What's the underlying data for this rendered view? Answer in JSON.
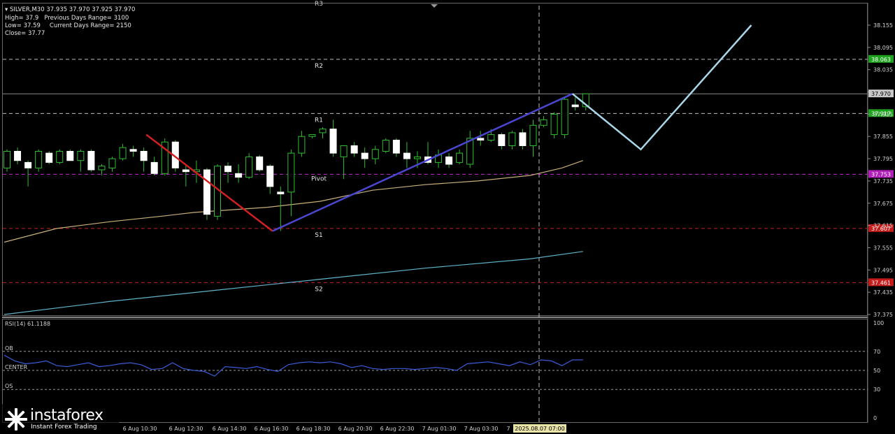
{
  "header": {
    "symbol_line": "SILVER,M30  37.935 37.970 37.925 37.970",
    "high": "High= 37.9",
    "prev_range": "Previous Days Range= 3100",
    "low": "Low= 37.59",
    "curr_range": "Current Days Range= 2150",
    "close": "Close= 37.77"
  },
  "colors": {
    "background": "#000000",
    "bull_candle": "#ffffff",
    "bear_candle": "#ffffff",
    "candle_outline": "#2fbf2f",
    "ma_slow": "#c9b07a",
    "ma_long": "#5fb3c8",
    "zigzag_down": "#d02020",
    "zigzag_up": "#4a46d0",
    "projection": "#a9d6e8",
    "rsi_line": "#3b5bd8",
    "r_level_label": "#1fa31f",
    "pivot_label": "#b01fb8",
    "s_level_label": "#c41b1b",
    "current_price_label": "#c8c8c8"
  },
  "chart_data": [
    {
      "type": "candlestick",
      "title": "SILVER,M30",
      "ylim": [
        37.36,
        38.21
      ],
      "y_ticks": [
        "38.155",
        "38.095",
        "38.035",
        "37.975",
        "37.915",
        "37.855",
        "37.795",
        "37.735",
        "37.675",
        "37.615",
        "37.555",
        "37.495",
        "37.435",
        "37.375"
      ],
      "x_ticks": [
        "6 Aug 10:30",
        "6 Aug 12:30",
        "6 Aug 14:30",
        "6 Aug 16:30",
        "6 Aug 18:30",
        "6 Aug 20:30",
        "6 Aug 22:30",
        "7 Aug 01:30",
        "7 Aug 03:30",
        "7",
        "2025.08.07 07:00"
      ],
      "levels": [
        {
          "name": "R2",
          "value": 38.063,
          "label": "38.063"
        },
        {
          "name": "R1",
          "value": 37.917,
          "label": "37.917"
        },
        {
          "name": "Pivot",
          "value": 37.753,
          "label": "37.753"
        },
        {
          "name": "S1",
          "value": 37.607,
          "label": "37.607"
        },
        {
          "name": "S2",
          "value": 37.461,
          "label": "37.461"
        }
      ],
      "current_price": {
        "value": 37.97,
        "label": "37.970"
      },
      "candles": [
        {
          "o": 37.77,
          "h": 37.82,
          "l": 37.76,
          "c": 37.815
        },
        {
          "o": 37.815,
          "h": 37.825,
          "l": 37.78,
          "c": 37.79
        },
        {
          "o": 37.785,
          "h": 37.79,
          "l": 37.72,
          "c": 37.77
        },
        {
          "o": 37.77,
          "h": 37.82,
          "l": 37.76,
          "c": 37.815
        },
        {
          "o": 37.81,
          "h": 37.815,
          "l": 37.78,
          "c": 37.785
        },
        {
          "o": 37.785,
          "h": 37.82,
          "l": 37.78,
          "c": 37.815
        },
        {
          "o": 37.815,
          "h": 37.82,
          "l": 37.79,
          "c": 37.79
        },
        {
          "o": 37.79,
          "h": 37.82,
          "l": 37.76,
          "c": 37.815
        },
        {
          "o": 37.815,
          "h": 37.82,
          "l": 37.76,
          "c": 37.765
        },
        {
          "o": 37.765,
          "h": 37.78,
          "l": 37.75,
          "c": 37.775
        },
        {
          "o": 37.77,
          "h": 37.8,
          "l": 37.76,
          "c": 37.795
        },
        {
          "o": 37.795,
          "h": 37.835,
          "l": 37.79,
          "c": 37.825
        },
        {
          "o": 37.82,
          "h": 37.83,
          "l": 37.8,
          "c": 37.815
        },
        {
          "o": 37.815,
          "h": 37.825,
          "l": 37.76,
          "c": 37.79
        },
        {
          "o": 37.785,
          "h": 37.8,
          "l": 37.75,
          "c": 37.755
        },
        {
          "o": 37.755,
          "h": 37.85,
          "l": 37.75,
          "c": 37.84
        },
        {
          "o": 37.84,
          "h": 37.845,
          "l": 37.76,
          "c": 37.77
        },
        {
          "o": 37.765,
          "h": 37.78,
          "l": 37.72,
          "c": 37.76
        },
        {
          "o": 37.76,
          "h": 37.79,
          "l": 37.73,
          "c": 37.765
        },
        {
          "o": 37.765,
          "h": 37.77,
          "l": 37.63,
          "c": 37.645
        },
        {
          "o": 37.64,
          "h": 37.78,
          "l": 37.63,
          "c": 37.775
        },
        {
          "o": 37.775,
          "h": 37.785,
          "l": 37.73,
          "c": 37.76
        },
        {
          "o": 37.755,
          "h": 37.78,
          "l": 37.73,
          "c": 37.745
        },
        {
          "o": 37.745,
          "h": 37.81,
          "l": 37.74,
          "c": 37.8
        },
        {
          "o": 37.8,
          "h": 37.805,
          "l": 37.76,
          "c": 37.765
        },
        {
          "o": 37.775,
          "h": 37.78,
          "l": 37.7,
          "c": 37.72
        },
        {
          "o": 37.705,
          "h": 37.72,
          "l": 37.6,
          "c": 37.7
        },
        {
          "o": 37.705,
          "h": 37.82,
          "l": 37.64,
          "c": 37.81
        },
        {
          "o": 37.81,
          "h": 37.87,
          "l": 37.8,
          "c": 37.855
        },
        {
          "o": 37.855,
          "h": 37.86,
          "l": 37.85,
          "c": 37.86
        },
        {
          "o": 37.865,
          "h": 37.88,
          "l": 37.85,
          "c": 37.875
        },
        {
          "o": 37.875,
          "h": 37.9,
          "l": 37.8,
          "c": 37.81
        },
        {
          "o": 37.8,
          "h": 37.81,
          "l": 37.74,
          "c": 37.83
        },
        {
          "o": 37.83,
          "h": 37.84,
          "l": 37.8,
          "c": 37.81
        },
        {
          "o": 37.81,
          "h": 37.825,
          "l": 37.77,
          "c": 37.795
        },
        {
          "o": 37.795,
          "h": 37.83,
          "l": 37.78,
          "c": 37.82
        },
        {
          "o": 37.815,
          "h": 37.85,
          "l": 37.81,
          "c": 37.845
        },
        {
          "o": 37.845,
          "h": 37.85,
          "l": 37.8,
          "c": 37.81
        },
        {
          "o": 37.81,
          "h": 37.84,
          "l": 37.77,
          "c": 37.795
        },
        {
          "o": 37.795,
          "h": 37.815,
          "l": 37.77,
          "c": 37.8
        },
        {
          "o": 37.8,
          "h": 37.84,
          "l": 37.78,
          "c": 37.785
        },
        {
          "o": 37.785,
          "h": 37.82,
          "l": 37.77,
          "c": 37.805
        },
        {
          "o": 37.8,
          "h": 37.81,
          "l": 37.77,
          "c": 37.78
        },
        {
          "o": 37.785,
          "h": 37.82,
          "l": 37.78,
          "c": 37.81
        },
        {
          "o": 37.78,
          "h": 37.87,
          "l": 37.77,
          "c": 37.85
        },
        {
          "o": 37.85,
          "h": 37.87,
          "l": 37.83,
          "c": 37.845
        },
        {
          "o": 37.845,
          "h": 37.875,
          "l": 37.84,
          "c": 37.86
        },
        {
          "o": 37.86,
          "h": 37.865,
          "l": 37.82,
          "c": 37.83
        },
        {
          "o": 37.83,
          "h": 37.87,
          "l": 37.82,
          "c": 37.865
        },
        {
          "o": 37.865,
          "h": 37.875,
          "l": 37.82,
          "c": 37.83
        },
        {
          "o": 37.83,
          "h": 37.9,
          "l": 37.8,
          "c": 37.885
        },
        {
          "o": 37.885,
          "h": 37.91,
          "l": 37.88,
          "c": 37.9
        },
        {
          "o": 37.86,
          "h": 37.92,
          "l": 37.85,
          "c": 37.915
        },
        {
          "o": 37.86,
          "h": 37.96,
          "l": 37.85,
          "c": 37.955
        },
        {
          "o": 37.94,
          "h": 37.96,
          "l": 37.925,
          "c": 37.935
        },
        {
          "o": 37.935,
          "h": 37.97,
          "l": 37.925,
          "c": 37.97
        }
      ],
      "ma_slow": [
        [
          0,
          37.57
        ],
        [
          5,
          37.607
        ],
        [
          10,
          37.625
        ],
        [
          15,
          37.64
        ],
        [
          18,
          37.65
        ],
        [
          25,
          37.664
        ],
        [
          30,
          37.68
        ],
        [
          35,
          37.71
        ],
        [
          40,
          37.725
        ],
        [
          45,
          37.735
        ],
        [
          50,
          37.75
        ],
        [
          53,
          37.77
        ],
        [
          55,
          37.79
        ]
      ],
      "ma_long": [
        [
          0,
          37.375
        ],
        [
          10,
          37.41
        ],
        [
          20,
          37.44
        ],
        [
          30,
          37.47
        ],
        [
          40,
          37.5
        ],
        [
          50,
          37.525
        ],
        [
          55,
          37.545
        ]
      ],
      "zigzag": [
        [
          13.5,
          37.86
        ],
        [
          25.5,
          37.6
        ],
        [
          54,
          37.97
        ]
      ],
      "projection": [
        [
          54,
          37.97
        ],
        [
          60.5,
          37.82
        ],
        [
          71,
          38.155
        ]
      ]
    },
    {
      "type": "line",
      "title": "RSI(14) 61.1188",
      "ylim": [
        0,
        100
      ],
      "y_ticks": [
        "100",
        "70",
        "50",
        "30",
        "0"
      ],
      "levels": [
        {
          "name": "OB",
          "value": 70
        },
        {
          "name": "CENTER",
          "value": 50
        },
        {
          "name": "OS",
          "value": 30
        }
      ],
      "values": [
        66,
        60,
        57,
        58,
        60,
        55,
        54,
        56,
        58,
        54,
        55,
        57,
        58,
        56,
        51,
        52,
        58,
        52,
        50,
        49,
        44,
        54,
        53,
        52,
        54,
        51,
        49,
        56,
        58,
        59,
        58,
        59,
        57,
        53,
        55,
        52,
        51,
        52,
        52,
        51,
        52,
        53,
        52,
        50,
        57,
        58,
        59,
        57,
        55,
        59,
        56,
        61,
        60,
        55,
        61,
        61.1188
      ]
    }
  ]
}
